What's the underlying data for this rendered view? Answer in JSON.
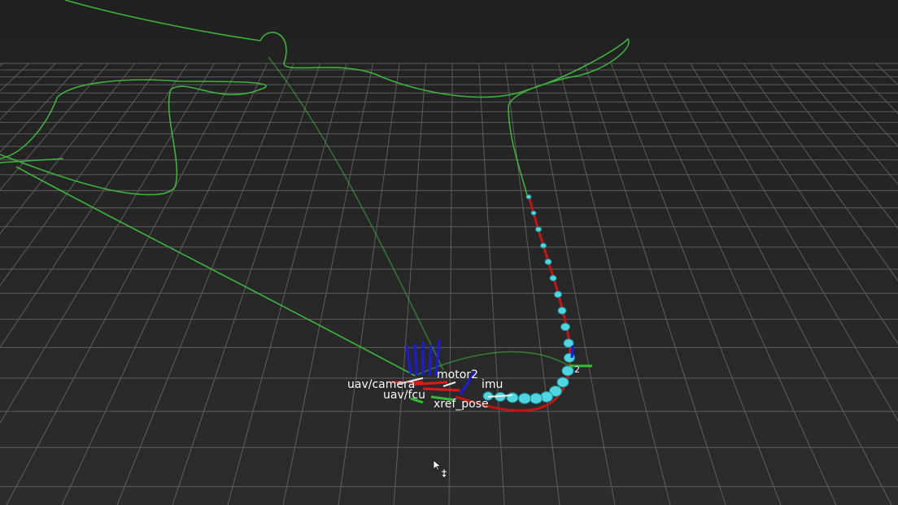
{
  "scene": {
    "background_color": "#222222",
    "grid_color": "#8a8a8a",
    "trajectory_color": "#3fc13f",
    "reference_path_color": "#c41414",
    "marker_color": "#4fd6e0",
    "axis_blue": "#1a1ae6",
    "axis_red": "#e01818",
    "axis_green": "#2fc02f"
  },
  "frame_labels": {
    "motor2": "motor2",
    "camera_chain": "uav/camera",
    "imu": "imu",
    "fcu": "uav/fcu",
    "ref_pose": "xref_pose",
    "right_tag": "2"
  },
  "cursor": {
    "icon": "move-cursor-icon"
  }
}
